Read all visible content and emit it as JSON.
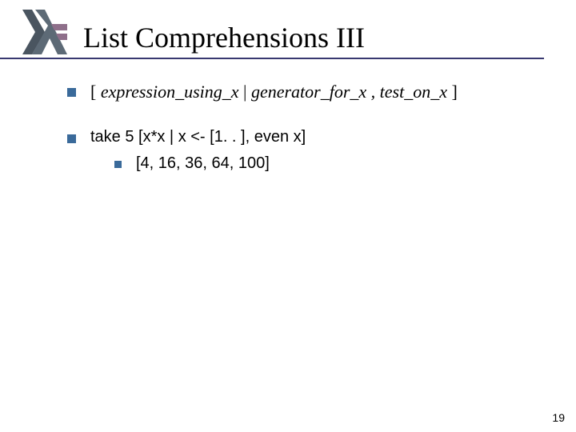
{
  "title": "List Comprehensions III",
  "bullets": {
    "b1": {
      "open": "[ ",
      "expr": "expression_using_x",
      "sep1": " | ",
      "gen": "generator_for_x",
      "comma": " , ",
      "test": "test_on_x",
      "close": " ]"
    },
    "b2": {
      "line": "take 5 [x*x | x <- [1. . ], even x]",
      "sub": "[4, 16, 36, 64, 100]"
    }
  },
  "pageNumber": "19",
  "logo": {
    "name": "haskell-logo",
    "colors": {
      "bar": "#4a5560",
      "lambda": "#5d6a76",
      "arrows": "#8e6f8a"
    }
  }
}
